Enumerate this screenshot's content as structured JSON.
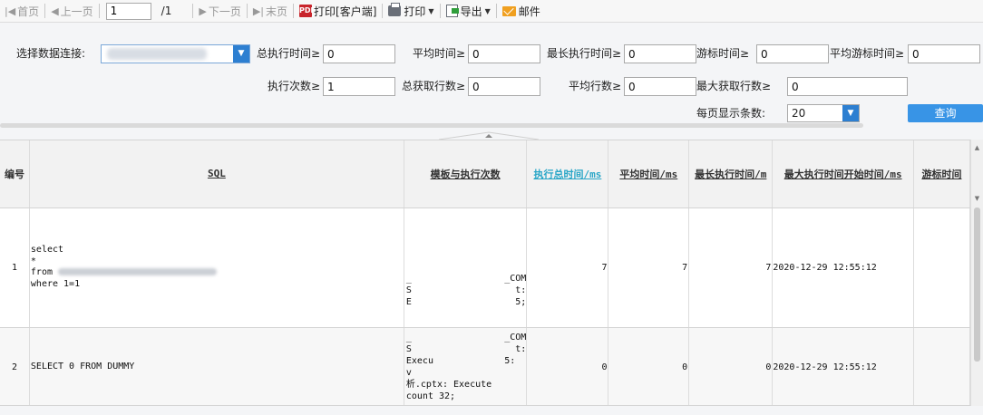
{
  "toolbar": {
    "first": "首页",
    "prev": "上一页",
    "page_value": "1",
    "page_total": "/1",
    "next": "下一页",
    "last": "末页",
    "print_client": "打印[客户端]",
    "print": "打印",
    "export": "导出",
    "mail": "邮件"
  },
  "filters": {
    "connection_label": "选择数据连接:",
    "total_exec_time_label": "总执行时间≥",
    "total_exec_time_value": "0",
    "avg_time_label": "平均时间≥",
    "avg_time_value": "0",
    "max_exec_time_label": "最长执行时间≥",
    "max_exec_time_value": "0",
    "cursor_time_label": "游标时间≥",
    "cursor_time_value": "0",
    "avg_cursor_time_label": "平均游标时间≥",
    "avg_cursor_time_value": "0",
    "exec_count_label": "执行次数≥",
    "exec_count_value": "1",
    "total_fetch_rows_label": "总获取行数≥",
    "total_fetch_rows_value": "0",
    "avg_rows_label": "平均行数≥",
    "avg_rows_value": "0",
    "max_fetch_rows_label": "最大获取行数≥",
    "max_fetch_rows_value": "0",
    "page_size_label": "每页显示条数:",
    "page_size_value": "20",
    "query_button": "查询"
  },
  "table": {
    "headers": [
      "编号",
      "SQL",
      "模板与执行次数",
      "执行总时间/ms",
      "平均时间/ms",
      "最长执行时间/m",
      "最大执行时间开始时间/ms",
      "游标时间"
    ],
    "rows": [
      {
        "num": "1",
        "sql": [
          "select",
          "*",
          "from ",
          "where 1=1"
        ],
        "tpl": [
          "_                 _COM",
          "S                   t:",
          "E                   5;"
        ],
        "total": "7",
        "avg": "7",
        "max": "7",
        "start": "2020-12-29 12:55:12",
        "cursor": ""
      },
      {
        "num": "2",
        "sql": [
          "SELECT 0 FROM DUMMY"
        ],
        "tpl": [
          "_                 _COM",
          "S                   t:",
          "Execu             5:",
          "v                   ",
          "析.cptx: Execute",
          "count 32;"
        ],
        "total": "0",
        "avg": "0",
        "max": "0",
        "start": "2020-12-29 12:55:12",
        "cursor": ""
      }
    ]
  },
  "colors": {
    "accent": "#2d7fd1",
    "query_button": "#3894e6",
    "active_header": "#29a6c7",
    "print_client_icon": "#c8242b",
    "mail_icon": "#f0a020"
  }
}
